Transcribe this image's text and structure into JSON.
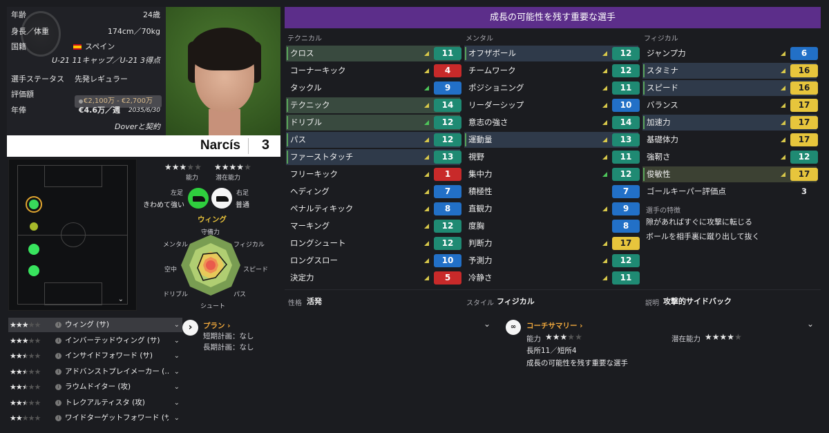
{
  "info": {
    "age_label": "年齢",
    "age_value": "24歳",
    "height_label": "身長／体重",
    "height_value": "174cm／70kg",
    "nation_label": "国籍",
    "nation_value": "スペイン",
    "caps": "U-21 11キャップ／U-21 3得点",
    "status_label": "選手ステータス",
    "status_value": "先発レギュラー",
    "value_label": "評価額",
    "value_value": "€2,100万 - €2,700万",
    "wage_label": "年俸",
    "wage_value": "€4.6万／週",
    "wage_date": "2035/6/30",
    "contract": "Doverと契約"
  },
  "player": {
    "name": "Narcís",
    "number": "3"
  },
  "ratings": {
    "ability_label": "能力",
    "potential_label": "潜在能力",
    "ability_stars": 3,
    "potential_stars": 4,
    "left_foot_label": "左足",
    "left_foot_value": "きわめて強い",
    "right_foot_label": "右足",
    "right_foot_value": "普通",
    "role": "ウィング"
  },
  "radar": {
    "labels": {
      "top": "守備力",
      "tr": "フィジカル",
      "r": "スピード",
      "br": "パス",
      "b": "シュート",
      "bl": "ドリブル",
      "l": "空中",
      "tl": "メンタル"
    }
  },
  "banner": "成長の可能性を残す重要な選手",
  "columns": {
    "technical": "テクニカル",
    "mental": "メンタル",
    "physical": "フィジカル"
  },
  "technical": [
    {
      "name": "クロス",
      "value": "11",
      "color": "teal",
      "hl": "hl",
      "tri": "y"
    },
    {
      "name": "コーナーキック",
      "value": "4",
      "color": "red",
      "hl": "",
      "tri": "y"
    },
    {
      "name": "タックル",
      "value": "9",
      "color": "blue",
      "hl": "",
      "tri": "g"
    },
    {
      "name": "テクニック",
      "value": "14",
      "color": "teal",
      "hl": "hl",
      "tri": "y"
    },
    {
      "name": "ドリブル",
      "value": "12",
      "color": "teal",
      "hl": "hl",
      "tri": "g"
    },
    {
      "name": "パス",
      "value": "12",
      "color": "teal",
      "hl": "hl2",
      "tri": "y"
    },
    {
      "name": "ファーストタッチ",
      "value": "13",
      "color": "teal",
      "hl": "hl2",
      "tri": "y"
    },
    {
      "name": "フリーキック",
      "value": "1",
      "color": "red",
      "hl": "",
      "tri": "y"
    },
    {
      "name": "ヘディング",
      "value": "7",
      "color": "blue",
      "hl": "",
      "tri": "y"
    },
    {
      "name": "ペナルティキック",
      "value": "8",
      "color": "blue",
      "hl": "",
      "tri": "y"
    },
    {
      "name": "マーキング",
      "value": "12",
      "color": "teal",
      "hl": "",
      "tri": "y"
    },
    {
      "name": "ロングシュート",
      "value": "12",
      "color": "teal",
      "hl": "",
      "tri": "y"
    },
    {
      "name": "ロングスロー",
      "value": "10",
      "color": "blue",
      "hl": "",
      "tri": "y"
    },
    {
      "name": "決定力",
      "value": "5",
      "color": "red",
      "hl": "",
      "tri": "y"
    }
  ],
  "mental": [
    {
      "name": "オフザボール",
      "value": "12",
      "color": "teal",
      "hl": "hl2",
      "tri": "y"
    },
    {
      "name": "チームワーク",
      "value": "12",
      "color": "teal",
      "hl": "",
      "tri": "y"
    },
    {
      "name": "ポジショニング",
      "value": "11",
      "color": "teal",
      "hl": "",
      "tri": "y"
    },
    {
      "name": "リーダーシップ",
      "value": "10",
      "color": "blue",
      "hl": "",
      "tri": "y"
    },
    {
      "name": "意志の強さ",
      "value": "14",
      "color": "teal",
      "hl": "",
      "tri": "y"
    },
    {
      "name": "運動量",
      "value": "13",
      "color": "teal",
      "hl": "hl2",
      "tri": "y"
    },
    {
      "name": "視野",
      "value": "11",
      "color": "teal",
      "hl": "",
      "tri": "y"
    },
    {
      "name": "集中力",
      "value": "12",
      "color": "teal",
      "hl": "",
      "tri": "g"
    },
    {
      "name": "積極性",
      "value": "7",
      "color": "blue",
      "hl": "",
      "tri": ""
    },
    {
      "name": "直観力",
      "value": "9",
      "color": "blue",
      "hl": "",
      "tri": "y"
    },
    {
      "name": "度胸",
      "value": "8",
      "color": "blue",
      "hl": "",
      "tri": ""
    },
    {
      "name": "判断力",
      "value": "17",
      "color": "yellow",
      "hl": "",
      "tri": "y"
    },
    {
      "name": "予測力",
      "value": "12",
      "color": "teal",
      "hl": "",
      "tri": "y"
    },
    {
      "name": "冷静さ",
      "value": "11",
      "color": "teal",
      "hl": "",
      "tri": "y"
    }
  ],
  "physical": [
    {
      "name": "ジャンプ力",
      "value": "6",
      "color": "blue",
      "hl": "",
      "tri": "y"
    },
    {
      "name": "スタミナ",
      "value": "16",
      "color": "yellow",
      "hl": "hl2",
      "tri": "y"
    },
    {
      "name": "スピード",
      "value": "16",
      "color": "yellow",
      "hl": "hl2",
      "tri": "y"
    },
    {
      "name": "バランス",
      "value": "17",
      "color": "yellow",
      "hl": "",
      "tri": "y"
    },
    {
      "name": "加速力",
      "value": "17",
      "color": "yellow",
      "hl": "hl2",
      "tri": "y"
    },
    {
      "name": "基礎体力",
      "value": "17",
      "color": "yellow",
      "hl": "",
      "tri": "y"
    },
    {
      "name": "強靭さ",
      "value": "12",
      "color": "teal",
      "hl": "",
      "tri": "y"
    },
    {
      "name": "俊敏性",
      "value": "17",
      "color": "yellow",
      "hl": "hlg",
      "tri": "y"
    }
  ],
  "gk_rating": {
    "label": "ゴールキーパー評価点",
    "value": "3"
  },
  "traits": {
    "title": "選手の特徴",
    "items": [
      "隙があればすぐに攻撃に転じる",
      "ボールを相手裏に蹴り出して抜く"
    ]
  },
  "footer": {
    "personality_label": "性格",
    "personality_value": "活発",
    "style_label": "スタイル",
    "style_value": "フィジカル",
    "desc_label": "説明",
    "desc_value": "攻撃的サイドバック"
  },
  "roles": [
    {
      "name": "ウィング (サ)",
      "stars": 3.0,
      "selected": true
    },
    {
      "name": "インバーテッドウィング (サ)",
      "stars": 3.0,
      "selected": false
    },
    {
      "name": "インサイドフォワード (サ)",
      "stars": 2.5,
      "selected": false
    },
    {
      "name": "アドバンストプレイメーカー (…",
      "stars": 2.5,
      "selected": false
    },
    {
      "name": "ラウムドイター (攻)",
      "stars": 2.5,
      "selected": false
    },
    {
      "name": "トレクアルティスタ (攻)",
      "stars": 2.5,
      "selected": false
    },
    {
      "name": "ワイドターゲットフォワード (サ)",
      "stars": 2.0,
      "selected": false
    }
  ],
  "plan": {
    "title": "プラン",
    "short": "短期計画：なし",
    "long": "長期計画：なし"
  },
  "coach": {
    "title": "コーチサマリー",
    "ability_label": "能力",
    "ability_stars": 3,
    "potential_label": "潜在能力",
    "potential_stars": 4,
    "strengths": "長所11／短所4",
    "summary": "成長の可能性を残す重要な選手"
  }
}
